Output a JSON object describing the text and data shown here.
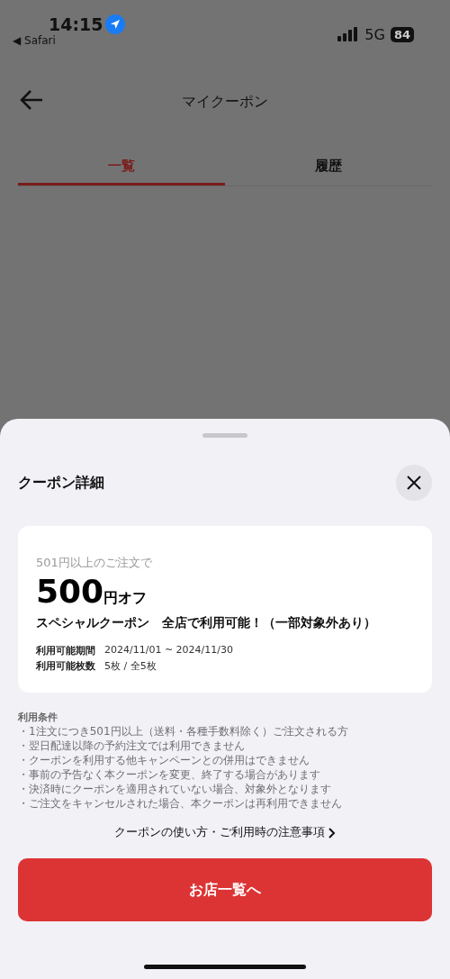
{
  "status_bar": {
    "time": "14:15",
    "back_app": "◀ Safari",
    "network": "5G",
    "battery": "84"
  },
  "header": {
    "title": "マイクーポン"
  },
  "tabs": [
    {
      "label": "一覧",
      "selected": true
    },
    {
      "label": "履歴",
      "selected": false
    }
  ],
  "sheet": {
    "title": "クーポン詳細",
    "coupon": {
      "condition": "501円以上のご注文で",
      "amount": "500",
      "unit": "円オフ",
      "name": "スペシャルクーポン　全店で利用可能！（一部対象外あり）",
      "details": [
        {
          "label": "利用可能期間",
          "value": "2024/11/01 ~ 2024/11/30"
        },
        {
          "label": "利用可能枚数",
          "value": "5枚 / 全5枚"
        }
      ]
    },
    "terms_title": "利用条件",
    "terms": [
      "・1注文につき501円以上（送料・各種手数料除く）ご注文される方",
      "・翌日配達以降の予約注文では利用できません",
      "・クーポンを利用する他キャンペーンとの併用はできません",
      "・事前の予告なく本クーポンを変更、終了する場合があります",
      "・決済時にクーポンを適用されていない場合、対象外となります",
      "・ご注文をキャンセルされた場合、本クーポンは再利用できません"
    ],
    "link": "クーポンの使い方・ご利用時の注意事項",
    "button": "お店一覧へ"
  }
}
